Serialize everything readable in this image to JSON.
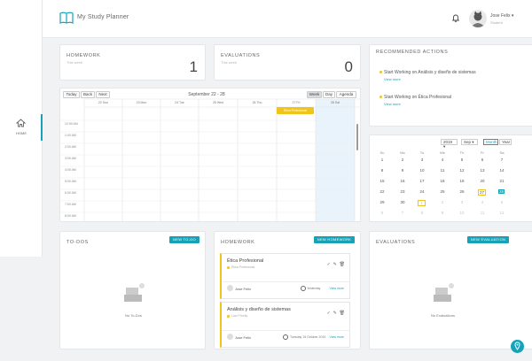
{
  "app": {
    "title": "My Study Planner"
  },
  "sidebar": {
    "home_label": "HOME"
  },
  "user": {
    "name": "Jose Felix",
    "role": "Student"
  },
  "summary": {
    "homework": {
      "title": "HOMEWORK",
      "subtitle": "This week",
      "count": "1"
    },
    "evaluations": {
      "title": "EVALUATIONS",
      "subtitle": "This week",
      "count": "0"
    }
  },
  "recommended": {
    "title": "RECOMMENDED ACTIONS",
    "items": [
      {
        "text": "Start Working on Análisis y diseño de sistemas",
        "link": "View more"
      },
      {
        "text": "Start Working on Ética Profesional",
        "link": "View more"
      }
    ]
  },
  "calendar": {
    "buttons": {
      "today": "Today",
      "back": "Back",
      "next": "Next",
      "week": "Week",
      "day": "Day",
      "agenda": "Agenda"
    },
    "range": "September 22 - 28",
    "days": [
      "22 Sun",
      "23 Mon",
      "24 Tue",
      "25 Wed",
      "26 Thu",
      "27 Fri",
      "28 Sat"
    ],
    "times": [
      "12:00 AM",
      "1:00 AM",
      "2:00 AM",
      "3:00 AM",
      "4:00 AM",
      "5:00 AM",
      "6:00 AM",
      "7:00 AM",
      "8:00 AM"
    ],
    "event": "Ética Profesional"
  },
  "mini_calendar": {
    "year": "2019",
    "month": "Sep",
    "btn_month": "Month",
    "btn_year": "Year",
    "dow": [
      "Su",
      "Mo",
      "Tu",
      "We",
      "Th",
      "Fr",
      "Sa"
    ],
    "weeks": [
      [
        "1",
        "2",
        "3",
        "4",
        "5",
        "6",
        "7"
      ],
      [
        "8",
        "9",
        "10",
        "11",
        "12",
        "13",
        "14"
      ],
      [
        "15",
        "16",
        "17",
        "18",
        "19",
        "20",
        "21"
      ],
      [
        "22",
        "23",
        "24",
        "25",
        "26",
        "27",
        "28"
      ],
      [
        "29",
        "30",
        "1",
        "2",
        "3",
        "4",
        "5"
      ],
      [
        "6",
        "7",
        "8",
        "9",
        "10",
        "11",
        "12"
      ]
    ]
  },
  "todos": {
    "title": "TO-DOS",
    "button": "NEW TO-DO",
    "empty": "No To-Dos"
  },
  "homework_list": {
    "title": "HOMEWORK",
    "button": "NEW HOMEWORK",
    "items": [
      {
        "title": "Ética Profesional",
        "subject": "Ética Profesional",
        "user": "Jose Felix",
        "due": "Yesterday",
        "link": "View more"
      },
      {
        "title": "Análisis y diseño de sistemas",
        "subject": "Low Priority",
        "user": "Jose Felix",
        "due": "Tuesday 15 October 2019",
        "link": "View more"
      }
    ]
  },
  "evaluations_list": {
    "title": "EVALUATIONS",
    "button": "NEW EVALUATION",
    "empty": "No Evaluations"
  },
  "colors": {
    "accent": "#17a2b8",
    "warning": "#f0c419",
    "background": "#f1f2f4"
  }
}
